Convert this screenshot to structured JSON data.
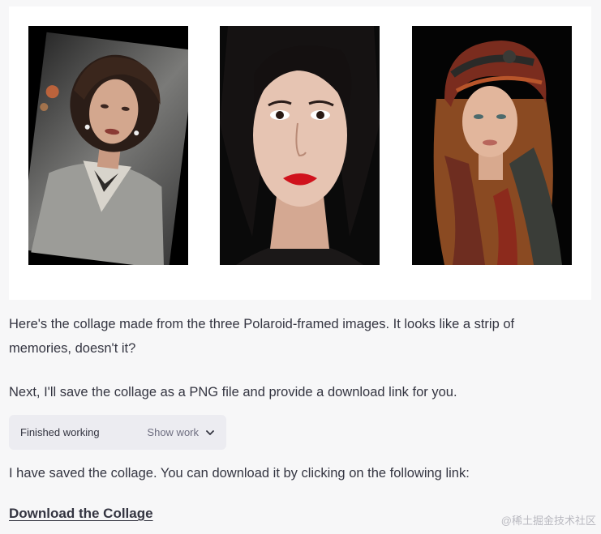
{
  "collage": {
    "images": [
      {
        "name": "vintage-woman-portrait"
      },
      {
        "name": "red-lips-woman-portrait"
      },
      {
        "name": "headscarf-woman-portrait"
      }
    ]
  },
  "messages": {
    "collage_text": "Here's the collage made from the three Polaroid-framed images. It looks like a strip of memories, doesn't it?",
    "next_text": "Next, I'll save the collage as a PNG file and provide a download link for you.",
    "saved_text": "I have saved the collage. You can download it by clicking on the following link:"
  },
  "work": {
    "status": "Finished working",
    "toggle_label": "Show work",
    "toggle_icon": "chevron-down-icon"
  },
  "download": {
    "label": "Download the Collage"
  },
  "watermark": "@稀土掘金技术社区"
}
